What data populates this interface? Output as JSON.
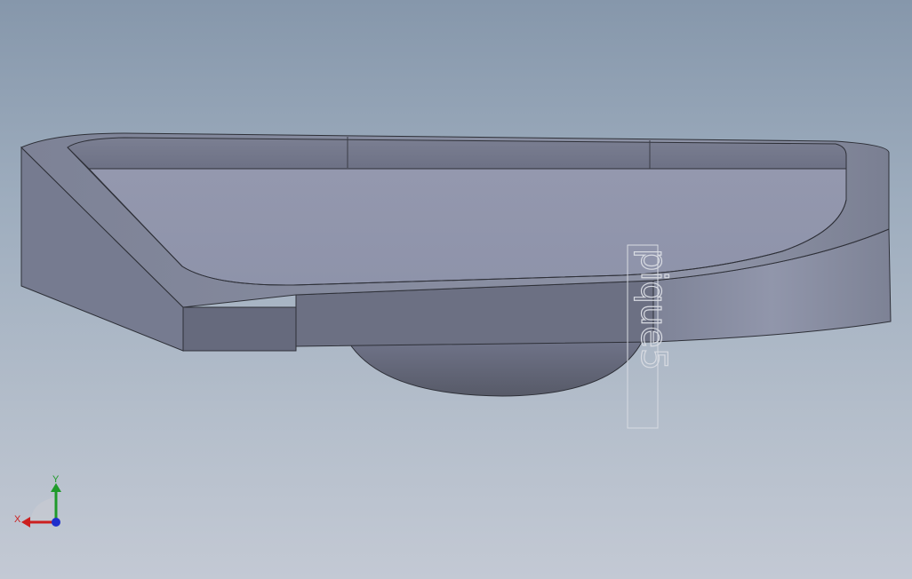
{
  "viewport": {
    "background_top": "#8697ab",
    "background_bottom": "#c3c9d4"
  },
  "model": {
    "body_color": "#8a8fa6",
    "top_face_color": "#9096ad",
    "side_face_color": "#6e7386",
    "edge_color": "#2e3038"
  },
  "sketch": {
    "text": "pique5"
  },
  "triad": {
    "x_label": "X",
    "y_label": "Y",
    "x_color": "#cc1f1f",
    "y_color": "#1f9a2a",
    "z_color": "#1f2fcc"
  }
}
